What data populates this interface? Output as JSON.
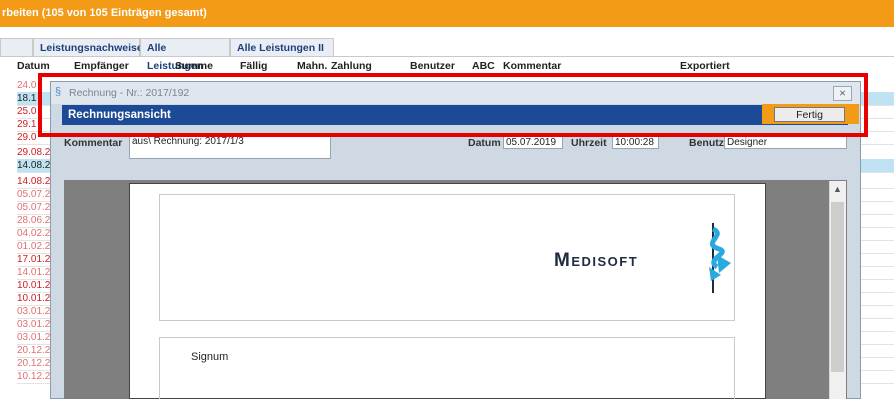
{
  "window": {
    "title": "rbeiten  (105 von 105 Einträgen gesamt)"
  },
  "tabs": [
    {
      "label": ""
    },
    {
      "label": "Leistungsnachweise"
    },
    {
      "label": "Alle Leistungen"
    },
    {
      "label": "Alle Leistungen II"
    }
  ],
  "table": {
    "headers": [
      "Datum",
      "Empfänger",
      "Summe",
      "Fällig",
      "Mahn.",
      "Zahlung",
      "Benutzer",
      "ABC",
      "Kommentar",
      "Exportiert"
    ],
    "rows": [
      "24.0",
      "18.1",
      "25.0",
      "29.1",
      "29.0",
      "29.08.2",
      "14.08.2",
      "14.08.2",
      "05.07.2",
      "05.07.2",
      "28.06.2",
      "04.02.2",
      "01.02.2",
      "17.01.2",
      "14.01.2",
      "10.01.2",
      "10.01.2",
      "03.01.2",
      "03.01.2",
      "03.01.2",
      "20.12.2",
      "20.12.2",
      "10.12.2"
    ]
  },
  "modal": {
    "title": "Rechnung - Nr.: 2017/192",
    "close": "⨯",
    "band_title": "Rechnungsansicht",
    "fertig": "Fertig",
    "kommentar_label": "Kommentar",
    "kommentar_value": "aus\\ Rechnung: 2017/1/3",
    "datum_label": "Datum",
    "datum_value": "05.07.2019",
    "uhrzeit_label": "Uhrzeit",
    "uhrzeit_value": "10:00:28",
    "benutzer_label": "Benutzer",
    "benutzer_value": "Designer"
  },
  "document": {
    "logo_text": "Medisoft",
    "signum": "Signum"
  },
  "colors": {
    "accent": "#f39a16",
    "band": "#1c4a96",
    "annotation": "#e60000"
  }
}
